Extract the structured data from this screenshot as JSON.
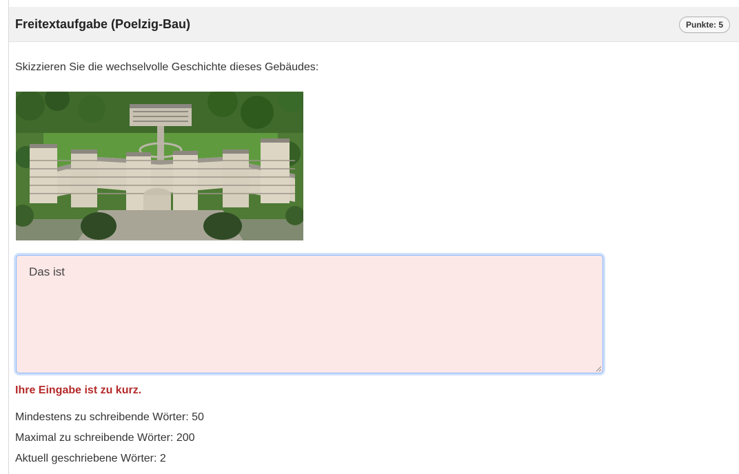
{
  "question": {
    "title": "Freitextaufgabe (Poelzig-Bau)",
    "points_badge": "Punkte: 5",
    "prompt": "Skizzieren Sie die wechselvolle Geschichte dieses Gebäudes:"
  },
  "image": {
    "subject": "poelzig-bau-aerial-photo"
  },
  "answer": {
    "value": "Das ist",
    "background_color": "#fde8e8",
    "focus_border_color": "#86b7fe"
  },
  "feedback": {
    "error": "Ihre Eingabe ist zu kurz.",
    "error_color": "#b52a2a"
  },
  "word_limits": {
    "min_label": "Mindestens zu schreibende Wörter: 50",
    "max_label": "Maximal zu schreibende Wörter: 200",
    "current_label": "Aktuell geschriebene Wörter: 2"
  }
}
